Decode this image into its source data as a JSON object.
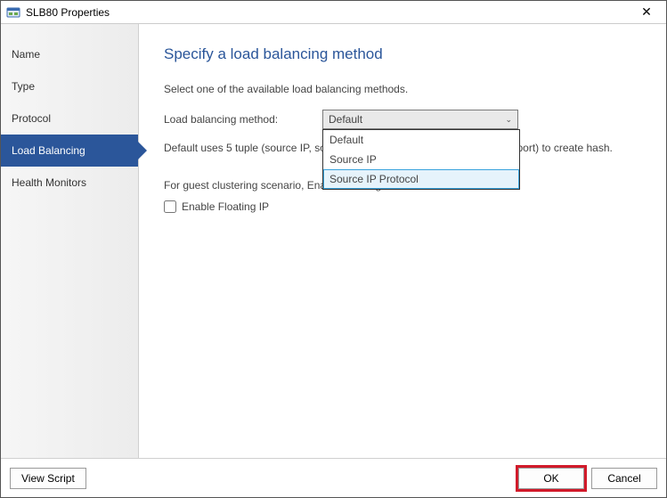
{
  "window": {
    "title": "SLB80 Properties",
    "close_glyph": "✕"
  },
  "sidebar": {
    "items": [
      {
        "label": "Name"
      },
      {
        "label": "Type"
      },
      {
        "label": "Protocol"
      },
      {
        "label": "Load Balancing"
      },
      {
        "label": "Health Monitors"
      }
    ],
    "active_index": 3
  },
  "content": {
    "heading": "Specify a load balancing method",
    "description": "Select one of the available load balancing methods.",
    "method_label": "Load balancing method:",
    "method_value": "Default",
    "method_options": [
      "Default",
      "Source IP",
      "Source IP Protocol"
    ],
    "method_hover_index": 2,
    "help_line1": "Default uses 5 tuple (source IP, source port, destination IP and destination port) to create hash.",
    "help_line1_visible": "Default uses 5 tuple (source                                              IP and destination port) to create h",
    "floating_help": "For guest clustering scenario, Enable Floating IP should be set.",
    "floating_checkbox_label": "Enable Floating IP",
    "floating_checked": false
  },
  "footer": {
    "view_script": "View Script",
    "ok": "OK",
    "cancel": "Cancel"
  }
}
